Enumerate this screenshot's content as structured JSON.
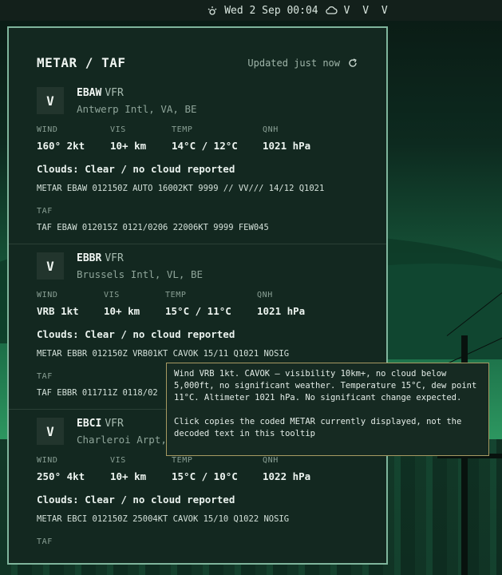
{
  "topbar": {
    "datetime": "Wed 2 Sep 00:04",
    "status": "V V V"
  },
  "panel": {
    "title": "METAR / TAF",
    "updated": "Updated just now"
  },
  "labels": {
    "wind": "WIND",
    "vis": "VIS",
    "temp": "TEMP",
    "qnh": "QNH",
    "taf": "TAF"
  },
  "stations": [
    {
      "badge": "V",
      "code": "EBAW",
      "category": "VFR",
      "location": "Antwerp Intl, VA, BE",
      "wind": "160° 2kt",
      "vis": "10+ km",
      "temp": "14°C / 12°C",
      "qnh": "1021 hPa",
      "clouds": "Clouds: Clear / no cloud reported",
      "metar": "METAR EBAW 012150Z AUTO 16002KT 9999 // VV/// 14/12 Q1021",
      "taf": "TAF EBAW 012015Z 0121/0206 22006KT 9999 FEW045"
    },
    {
      "badge": "V",
      "code": "EBBR",
      "category": "VFR",
      "location": "Brussels Intl, VL, BE",
      "wind": "VRB 1kt",
      "vis": "10+ km",
      "temp": "15°C / 11°C",
      "qnh": "1021 hPa",
      "clouds": "Clouds: Clear / no cloud reported",
      "metar": "METAR EBBR 012150Z VRB01KT CAVOK 15/11 Q1021 NOSIG",
      "taf": "TAF EBBR 011711Z 0118/02"
    },
    {
      "badge": "V",
      "code": "EBCI",
      "category": "VFR",
      "location": "Charleroi Arpt,",
      "wind": "250° 4kt",
      "vis": "10+ km",
      "temp": "15°C / 10°C",
      "qnh": "1022 hPa",
      "clouds": "Clouds: Clear / no cloud reported",
      "metar": "METAR EBCI 012150Z 25004KT CAVOK 15/10 Q1022 NOSIG",
      "taf": ""
    }
  ],
  "tooltip": {
    "line1": "Wind VRB 1kt. CAVOK — visibility 10km+, no cloud below 5,000ft, no significant weather. Temperature 15°C, dew point 11°C. Altimeter 1021 hPa. No significant change expected.",
    "line2": "Click copies the coded METAR currently displayed, not the decoded text in this tooltip"
  }
}
